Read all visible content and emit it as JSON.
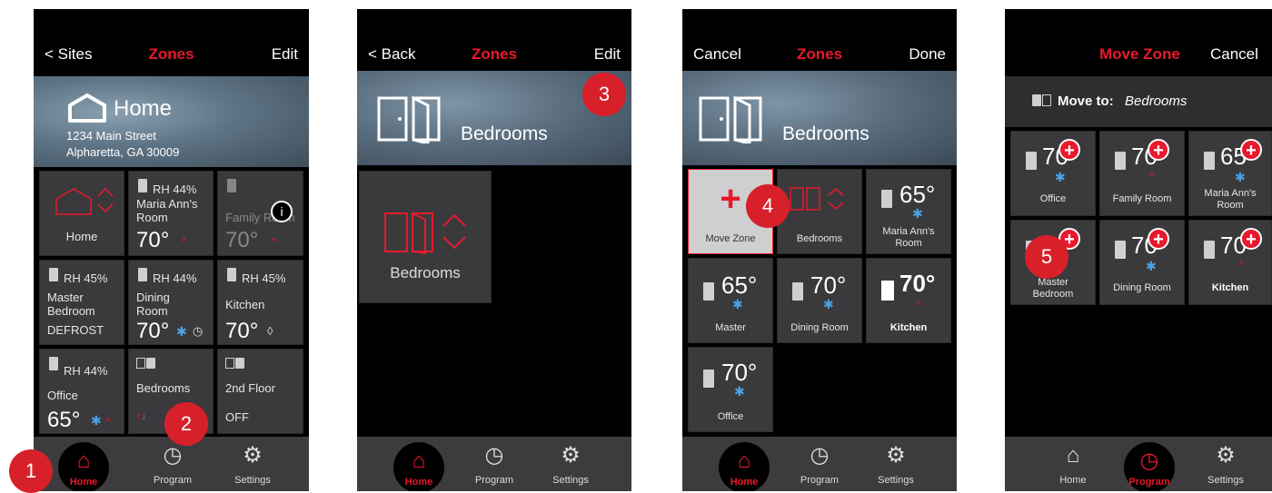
{
  "screens": [
    {
      "nav": {
        "left": "< Sites",
        "title": "Zones",
        "right": "Edit"
      },
      "banner": {
        "title": "Home",
        "address1": "1234 Main Street",
        "address2": "Alpharetta, GA 30009"
      },
      "tiles": {
        "home": {
          "name": "Home"
        },
        "maria": {
          "rh": "RH 44%",
          "name1": "Maria Ann's",
          "name2": "Room",
          "temp": "70°"
        },
        "family": {
          "name": "Family Room",
          "temp": "70°"
        },
        "master": {
          "rh": "RH 45%",
          "name1": "Master",
          "name2": "Bedroom",
          "status": "DEFROST"
        },
        "dining": {
          "rh": "RH 44%",
          "name1": "Dining",
          "name2": "Room",
          "temp": "70°"
        },
        "kitchen": {
          "rh": "RH 45%",
          "name": "Kitchen",
          "temp": "70°"
        },
        "office": {
          "rh": "RH 44%",
          "name": "Office",
          "temp": "65°"
        },
        "bedrooms": {
          "name": "Bedrooms"
        },
        "floor2": {
          "name": "2nd Floor",
          "status": "OFF"
        }
      },
      "tabs": {
        "home": "Home",
        "program": "Program",
        "settings": "Settings"
      }
    },
    {
      "nav": {
        "left": "< Back",
        "title": "Zones",
        "right": "Edit"
      },
      "banner": {
        "title": "Bedrooms"
      },
      "tiles": {
        "bedrooms": {
          "name": "Bedrooms"
        }
      },
      "tabs": {
        "home": "Home",
        "program": "Program",
        "settings": "Settings"
      }
    },
    {
      "nav": {
        "left": "Cancel",
        "title": "Zones",
        "right": "Done"
      },
      "banner": {
        "title": "Bedrooms"
      },
      "tiles": {
        "move": {
          "name": "Move Zone"
        },
        "bedrooms": {
          "name": "Bedrooms"
        },
        "maria": {
          "temp": "65°",
          "name1": "Maria Ann's",
          "name2": "Room"
        },
        "master": {
          "temp": "65°",
          "name": "Master"
        },
        "dining": {
          "temp": "70°",
          "name": "Dining Room"
        },
        "kitchen": {
          "temp": "70°",
          "name": "Kitchen"
        },
        "office": {
          "temp": "70°",
          "name": "Office"
        }
      },
      "tabs": {
        "home": "Home",
        "program": "Program",
        "settings": "Settings"
      }
    },
    {
      "nav": {
        "title": "Move Zone",
        "right": "Cancel"
      },
      "move_to": {
        "label": "Move to:",
        "target": "Bedrooms"
      },
      "tiles": {
        "office": {
          "temp": "70",
          "name": "Office"
        },
        "family": {
          "temp": "70",
          "name": "Family Room"
        },
        "maria": {
          "temp": "65",
          "name1": "Maria Ann's",
          "name2": "Room"
        },
        "master": {
          "name1": "Master",
          "name2": "Bedroom"
        },
        "dining": {
          "temp": "70",
          "name": "Dining Room"
        },
        "kitchen": {
          "temp": "70",
          "name": "Kitchen"
        }
      },
      "tabs": {
        "home": "Home",
        "program": "Program",
        "settings": "Settings"
      }
    }
  ],
  "callouts": [
    "1",
    "2",
    "3",
    "4",
    "5"
  ],
  "colors": {
    "accent": "#e8192c",
    "tile": "#3a3a3d",
    "cool": "#4aa3e6",
    "badge": "#d8202a"
  },
  "icons": {
    "home": "home-icon",
    "program": "stopwatch-icon",
    "settings": "gear-icon",
    "zone_door": "door-icon",
    "group": "double-door-icon",
    "flame": "flame-icon",
    "snowflake": "snowflake-icon",
    "info": "info-icon",
    "plus": "plus-icon"
  }
}
